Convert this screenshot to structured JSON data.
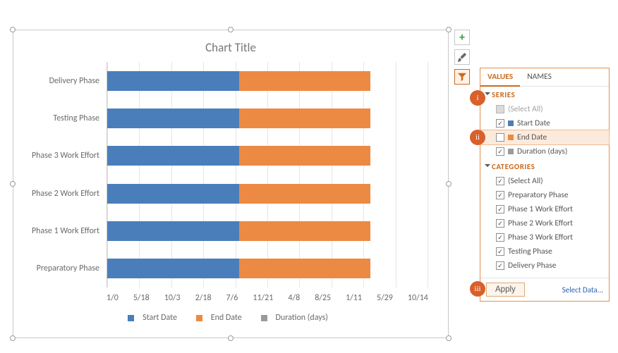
{
  "chart_data": {
    "type": "bar",
    "orientation": "horizontal",
    "stacked": true,
    "title": "Chart Title",
    "categories_display_order": [
      "Delivery Phase",
      "Testing Phase",
      "Phase 3 Work Effort",
      "Phase 2 Work Effort",
      "Phase 1 Work Effort",
      "Preparatory Phase"
    ],
    "x_ticks": [
      "1/0",
      "5/18",
      "10/3",
      "2/18",
      "7/6",
      "11/21",
      "4/8",
      "8/25",
      "1/11",
      "5/29",
      "10/14"
    ],
    "series": [
      {
        "name": "Start Date",
        "color": "#4a7ebb",
        "values": [
          0.41,
          0.41,
          0.41,
          0.41,
          0.41,
          0.41
        ]
      },
      {
        "name": "End Date",
        "color": "#ec8a43",
        "values": [
          0.41,
          0.41,
          0.41,
          0.41,
          0.41,
          0.41
        ]
      },
      {
        "name": "Duration (days)",
        "color": "#9a9a9a",
        "values": [
          0,
          0,
          0,
          0,
          0,
          0
        ]
      }
    ],
    "note": "series values are approximate fractions of the plot width as rendered in the source image"
  },
  "title": "Chart Title",
  "y_labels": [
    "Delivery Phase",
    "Testing Phase",
    "Phase 3 Work Effort",
    "Phase 2 Work Effort",
    "Phase 1 Work Effort",
    "Preparatory Phase"
  ],
  "x_labels": [
    "1/0",
    "5/18",
    "10/3",
    "2/18",
    "7/6",
    "11/21",
    "4/8",
    "8/25",
    "1/11",
    "5/29",
    "10/14"
  ],
  "legend": {
    "a": "Start Date",
    "b": "End Date",
    "c": "Duration (days)"
  },
  "side": {
    "plus": "+",
    "brush": "brush",
    "filter": "filter"
  },
  "panel": {
    "tab_values": "VALUES",
    "tab_names": "NAMES",
    "series_hdr": "SERIES",
    "categories_hdr": "CATEGORIES",
    "series": {
      "select_all": "(Select All)",
      "start_date": "Start Date",
      "end_date": "End Date",
      "duration": "Duration (days)"
    },
    "categories": {
      "select_all": "(Select All)",
      "c1": "Preparatory Phase",
      "c2": "Phase 1 Work Effort",
      "c3": "Phase 2 Work Effort",
      "c4": "Phase 3 Work Effort",
      "c5": "Testing Phase",
      "c6": "Delivery Phase"
    },
    "apply": "Apply",
    "select_data": "Select Data..."
  },
  "badges": {
    "i": "i",
    "ii": "ii",
    "iii": "iii"
  },
  "colors": {
    "series_start": "#4a7ebb",
    "series_end": "#ec8a43",
    "series_dur": "#9a9a9a",
    "accent": "#c96b1e"
  }
}
